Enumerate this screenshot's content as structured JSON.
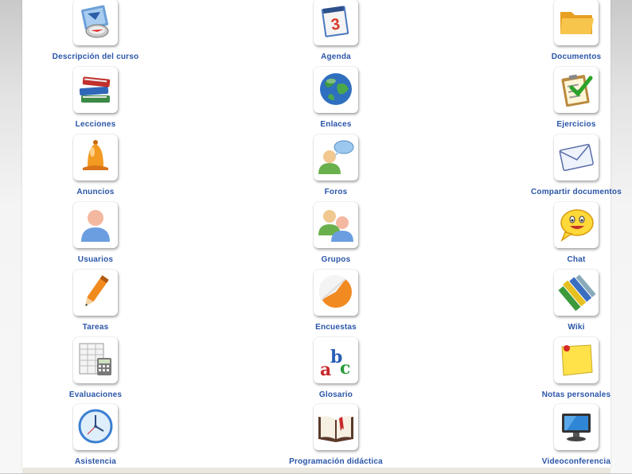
{
  "tools": {
    "descripcion": {
      "label": "Descripción del curso",
      "icon": "compass-icon"
    },
    "agenda": {
      "label": "Agenda",
      "icon": "calendar-icon"
    },
    "documentos": {
      "label": "Documentos",
      "icon": "folder-icon"
    },
    "lecciones": {
      "label": "Lecciones",
      "icon": "books-icon"
    },
    "enlaces": {
      "label": "Enlaces",
      "icon": "globe-icon"
    },
    "ejercicios": {
      "label": "Ejercicios",
      "icon": "checklist-icon"
    },
    "anuncios": {
      "label": "Anuncios",
      "icon": "bell-icon"
    },
    "foros": {
      "label": "Foros",
      "icon": "user-speech-icon"
    },
    "compartir": {
      "label": "Compartir documentos",
      "icon": "envelope-icon"
    },
    "usuarios": {
      "label": "Usuarios",
      "icon": "user-icon"
    },
    "grupos": {
      "label": "Grupos",
      "icon": "users-group-icon"
    },
    "chat": {
      "label": "Chat",
      "icon": "smiley-chat-icon"
    },
    "tareas": {
      "label": "Tareas",
      "icon": "pencil-icon"
    },
    "encuestas": {
      "label": "Encuestas",
      "icon": "pie-ball-icon"
    },
    "wiki": {
      "label": "Wiki",
      "icon": "crayons-icon"
    },
    "evaluaciones": {
      "label": "Evaluaciones",
      "icon": "spreadsheet-calculator-icon"
    },
    "glosario": {
      "label": "Glosario",
      "icon": "abc-letters-icon"
    },
    "notas": {
      "label": "Notas personales",
      "icon": "sticky-note-icon"
    },
    "asistencia": {
      "label": "Asistencia",
      "icon": "clock-icon"
    },
    "programacion": {
      "label": "Programación didáctica",
      "icon": "open-book-icon"
    },
    "videoconferencia": {
      "label": "Videoconferencia",
      "icon": "monitor-icon"
    }
  },
  "colors": {
    "label": "#2a55a8",
    "panel": "#ffffff",
    "background": "#e3e3e3"
  }
}
